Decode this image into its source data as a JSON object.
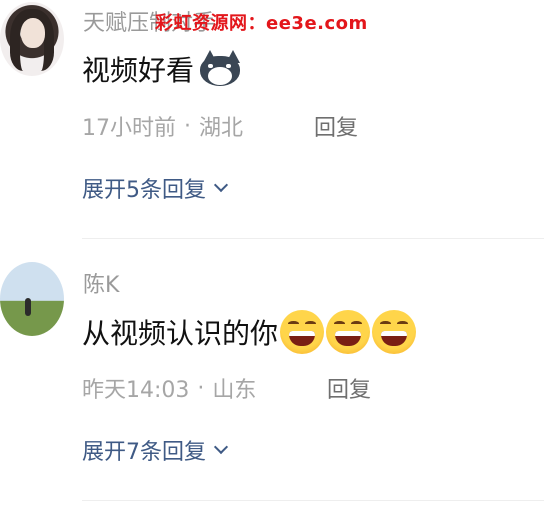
{
  "watermark": "彩虹资源网：ee3e.com",
  "comments": [
    {
      "username": "天赋压制对手",
      "text": "视频好看",
      "emoji": "husky-dog-emoji",
      "time": "17小时前",
      "location": "湖北",
      "reply_label": "回复",
      "expand_label": "展开5条回复"
    },
    {
      "username": "陈K",
      "text": "从视频认识的你",
      "emoji": "laughing-emoji",
      "emoji_count": 3,
      "time": "昨天14:03",
      "location": "山东",
      "reply_label": "回复",
      "expand_label": "展开7条回复"
    }
  ],
  "colors": {
    "username": "#9a9a9a",
    "meta": "#a6a6a6",
    "expand_link": "#3f5a85",
    "watermark": "#e3161b"
  }
}
